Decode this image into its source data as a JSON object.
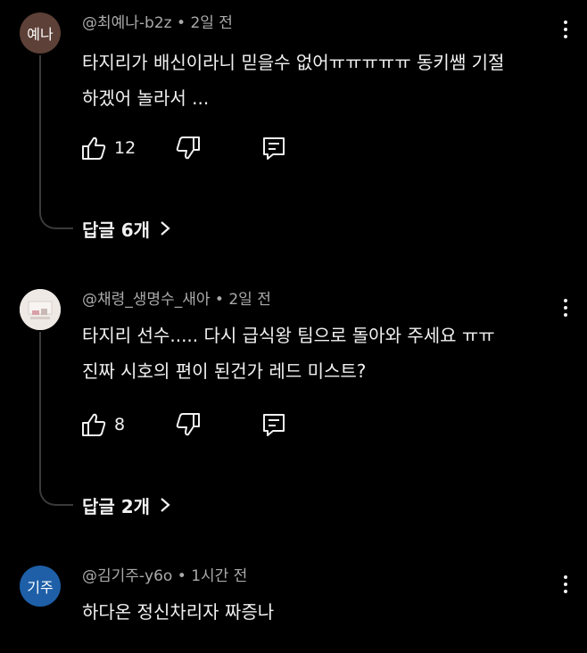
{
  "comments": [
    {
      "avatar_text": "예나",
      "avatar_color": "#5d4037",
      "author": "@최예나-b2z",
      "time": "2일 전",
      "lines": [
        "타지리가 배신이라니 믿을수 없어ㅠㅠㅠㅠㅠ 동키쌤 기절",
        "하겠어 놀라서 ..."
      ],
      "likes": "12",
      "replies_label": "답글 6개"
    },
    {
      "avatar_text": "",
      "avatar_color": "#e8e2e0",
      "author": "@채령_생명수_새아",
      "time": "2일 전",
      "lines": [
        "타지리 선수..... 다시 급식왕 팀으로 돌아와 주세요 ㅠㅠ",
        "진짜 시호의 편이 된건가 레드 미스트?"
      ],
      "likes": "8",
      "replies_label": "답글 2개"
    },
    {
      "avatar_text": "기주",
      "avatar_color": "#1e5fa8",
      "author": "@김기주-y6o",
      "time": "1시간 전",
      "lines": [
        "하다온 정신차리자 짜증나"
      ]
    }
  ],
  "separator": "•",
  "icons": {
    "like": "thumbs-up-icon",
    "dislike": "thumbs-down-icon",
    "reply": "reply-comment-icon",
    "more": "more-vertical-icon",
    "chevron": "chevron-right-icon"
  }
}
